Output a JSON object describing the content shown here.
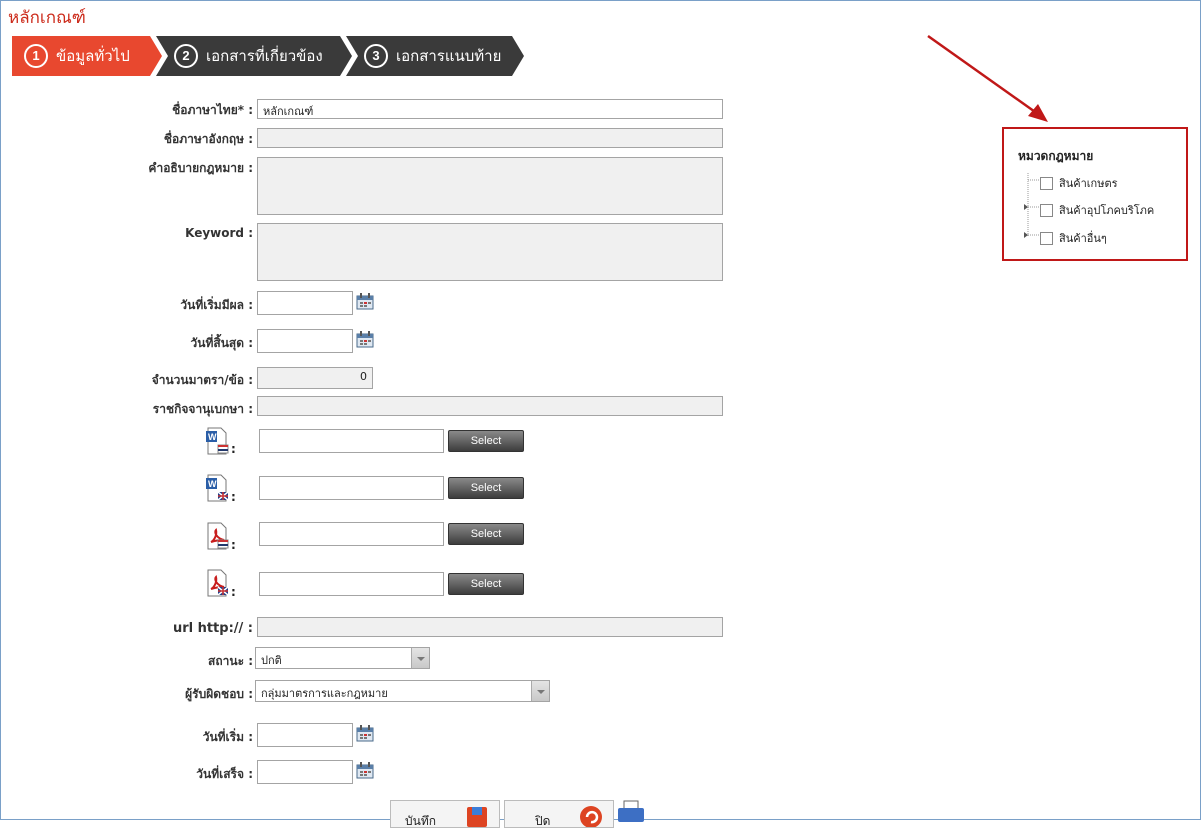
{
  "page": {
    "title": "หลักเกณฑ์"
  },
  "wizard": {
    "steps": [
      {
        "num": "1",
        "label": "ข้อมูลทั่วไป"
      },
      {
        "num": "2",
        "label": "เอกสารที่เกี่ยวข้อง"
      },
      {
        "num": "3",
        "label": "เอกสารแนบท้าย"
      }
    ],
    "active_color": "#e8482f",
    "inactive_color": "#3a3a3a"
  },
  "form": {
    "name_th_label": "ชื่อภาษาไทย* :",
    "name_th_value": "หลักเกณฑ์",
    "name_en_label": "ชื่อภาษาอังกฤษ :",
    "name_en_value": "",
    "desc_label": "คำอธิบายกฎหมาย :",
    "keyword_label": "Keyword :",
    "start_label": "วันที่เริ่มมีผล :",
    "end_label": "วันที่สิ้นสุด :",
    "count_label": "จำนวนมาตรา/ข้อ :",
    "count_value": "0",
    "gazette_label": "ราชกิจจานุเบกษา :",
    "select_label": "Select",
    "colon": ":",
    "url_label": "url http:// :",
    "status_label": "สถานะ :",
    "status_value": "ปกติ",
    "owner_label": "ผู้รับผิดชอบ :",
    "owner_value": "กลุ่มมาตรการและกฎหมาย",
    "begin_label": "วันที่เริ่ม :",
    "finish_label": "วันที่เสร็จ :"
  },
  "files": [
    {
      "icon": "word-th-icon"
    },
    {
      "icon": "word-en-icon"
    },
    {
      "icon": "pdf-th-icon"
    },
    {
      "icon": "pdf-en-icon"
    }
  ],
  "category": {
    "title": "หมวดกฎหมาย",
    "items": [
      "สินค้าเกษตร",
      "สินค้าอุปโภคบริโภค",
      "สินค้าอื่นๆ"
    ]
  },
  "buttons": {
    "save_label": "บันทึก",
    "close_label": "ปิด"
  }
}
